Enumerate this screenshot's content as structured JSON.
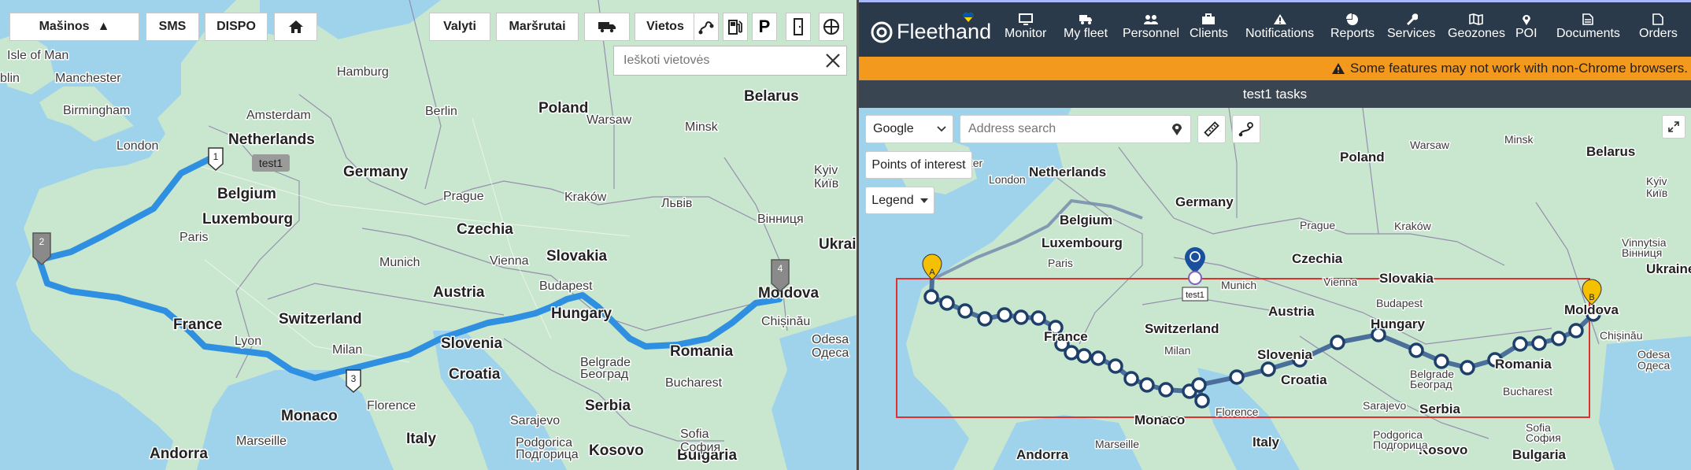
{
  "left_toolbar": {
    "vehicles_label": "Mašinos",
    "vehicles_arrow": "▲",
    "sms_label": "SMS",
    "dispo_label": "DISPO",
    "home_icon": "home-icon",
    "valyti_label": "Valyti",
    "marsrutai_label": "Maršrutai",
    "truck_icon": "truck-icon",
    "vietos_label": "Vietos",
    "route_icon": "route-icon",
    "fuel_icon": "fuel-pump-icon",
    "parking_label": "P",
    "door_icon": "door-icon",
    "crosshair_icon": "crosshair-icon"
  },
  "left_search": {
    "placeholder": "Ieškoti vietovės",
    "clear_icon": "close-icon"
  },
  "left_map": {
    "countries": [
      "Netherlands",
      "Germany",
      "Poland",
      "Belarus",
      "Belgium",
      "Luxembourg",
      "Czechia",
      "Slovakia",
      "Ukrai",
      "France",
      "Switzerland",
      "Austria",
      "Hungary",
      "Moldova",
      "Slovenia",
      "Croatia",
      "Romania",
      "Serbia",
      "Italy",
      "Monaco",
      "Andorra",
      "Bulgaria",
      "Kosovo"
    ],
    "cities": [
      "Isle of Man",
      "blin",
      "Manchester",
      "Birmingham",
      "London",
      "Amsterdam",
      "Hamburg",
      "Berlin",
      "Warsaw",
      "Minsk",
      "Prague",
      "Kraków",
      "Львів",
      "Paris",
      "Munich",
      "Vienna",
      "Budapest",
      "Kyiv",
      "Київ",
      "Вінниця",
      "Chișinău",
      "Lyon",
      "Milan",
      "Belgrade",
      "Београд",
      "Bucharest",
      "Florence",
      "Marseille",
      "Sarajevo",
      "Podgorica",
      "Подгорица",
      "Odesa",
      "Одеса",
      "Sofia",
      "София"
    ],
    "markers": [
      "1",
      "2",
      "3",
      "4"
    ],
    "vehicle_label": "test1"
  },
  "right_header": {
    "logo_text": "Fleethand",
    "nav": [
      {
        "label": "Monitor",
        "icon": "monitor-icon"
      },
      {
        "label": "My fleet",
        "icon": "truck-icon"
      },
      {
        "label": "Personnel",
        "icon": "people-icon"
      },
      {
        "label": "Clients",
        "icon": "briefcase-icon"
      },
      {
        "label": "Notifications",
        "icon": "warning-icon"
      },
      {
        "label": "Reports",
        "icon": "pie-chart-icon"
      },
      {
        "label": "Services",
        "icon": "wrench-icon"
      },
      {
        "label": "Geozones",
        "icon": "map-icon"
      },
      {
        "label": "POI",
        "icon": "pin-icon"
      },
      {
        "label": "Documents",
        "icon": "document-icon"
      },
      {
        "label": "Orders",
        "icon": "file-icon"
      }
    ]
  },
  "warning": {
    "text": "Some features may not work with non-Chrome browsers.",
    "icon": "warning-icon"
  },
  "tasks_bar": {
    "title": "test1 tasks"
  },
  "right_map": {
    "map_type_value": "Google",
    "address_placeholder": "Address search",
    "poi_button": "Points of interest",
    "legend_button": "Legend",
    "marker_a": "A",
    "marker_b": "B",
    "vehicle_label": "test1",
    "countries": [
      "Netherlands",
      "Germany",
      "Poland",
      "Belarus",
      "Belgium",
      "Luxembourg",
      "Czechia",
      "Slovakia",
      "Ukraine",
      "France",
      "Switzerland",
      "Austria",
      "Hungary",
      "Moldova",
      "Slovenia",
      "Croatia",
      "Romania",
      "Serbia",
      "Italy",
      "Monaco",
      "Andorra",
      "Bulgaria",
      "Kosovo"
    ],
    "cities": [
      "Manchester",
      "London",
      "Paris",
      "Munich",
      "Prague",
      "Kraków",
      "Vienna",
      "Budapest",
      "Kyiv",
      "Київ",
      "Vinnytsia",
      "Вінниця",
      "Milan",
      "Belgrade",
      "Београд",
      "Bucharest",
      "Florence",
      "Sarajevo",
      "Marseille",
      "Podgorica",
      "Подгорица",
      "Odesa",
      "Одеса",
      "Sofia",
      "София",
      "Chișinău",
      "Warsaw",
      "Minsk"
    ]
  },
  "colors": {
    "nav_bg": "#2b3a4a",
    "warning_bg": "#f39a1e",
    "tasks_bg": "#3a4552",
    "route_left": "#2f8fe0",
    "route_right": "#4a6f9a",
    "selection_box": "#e03030",
    "marker_yellow": "#f5c000"
  }
}
